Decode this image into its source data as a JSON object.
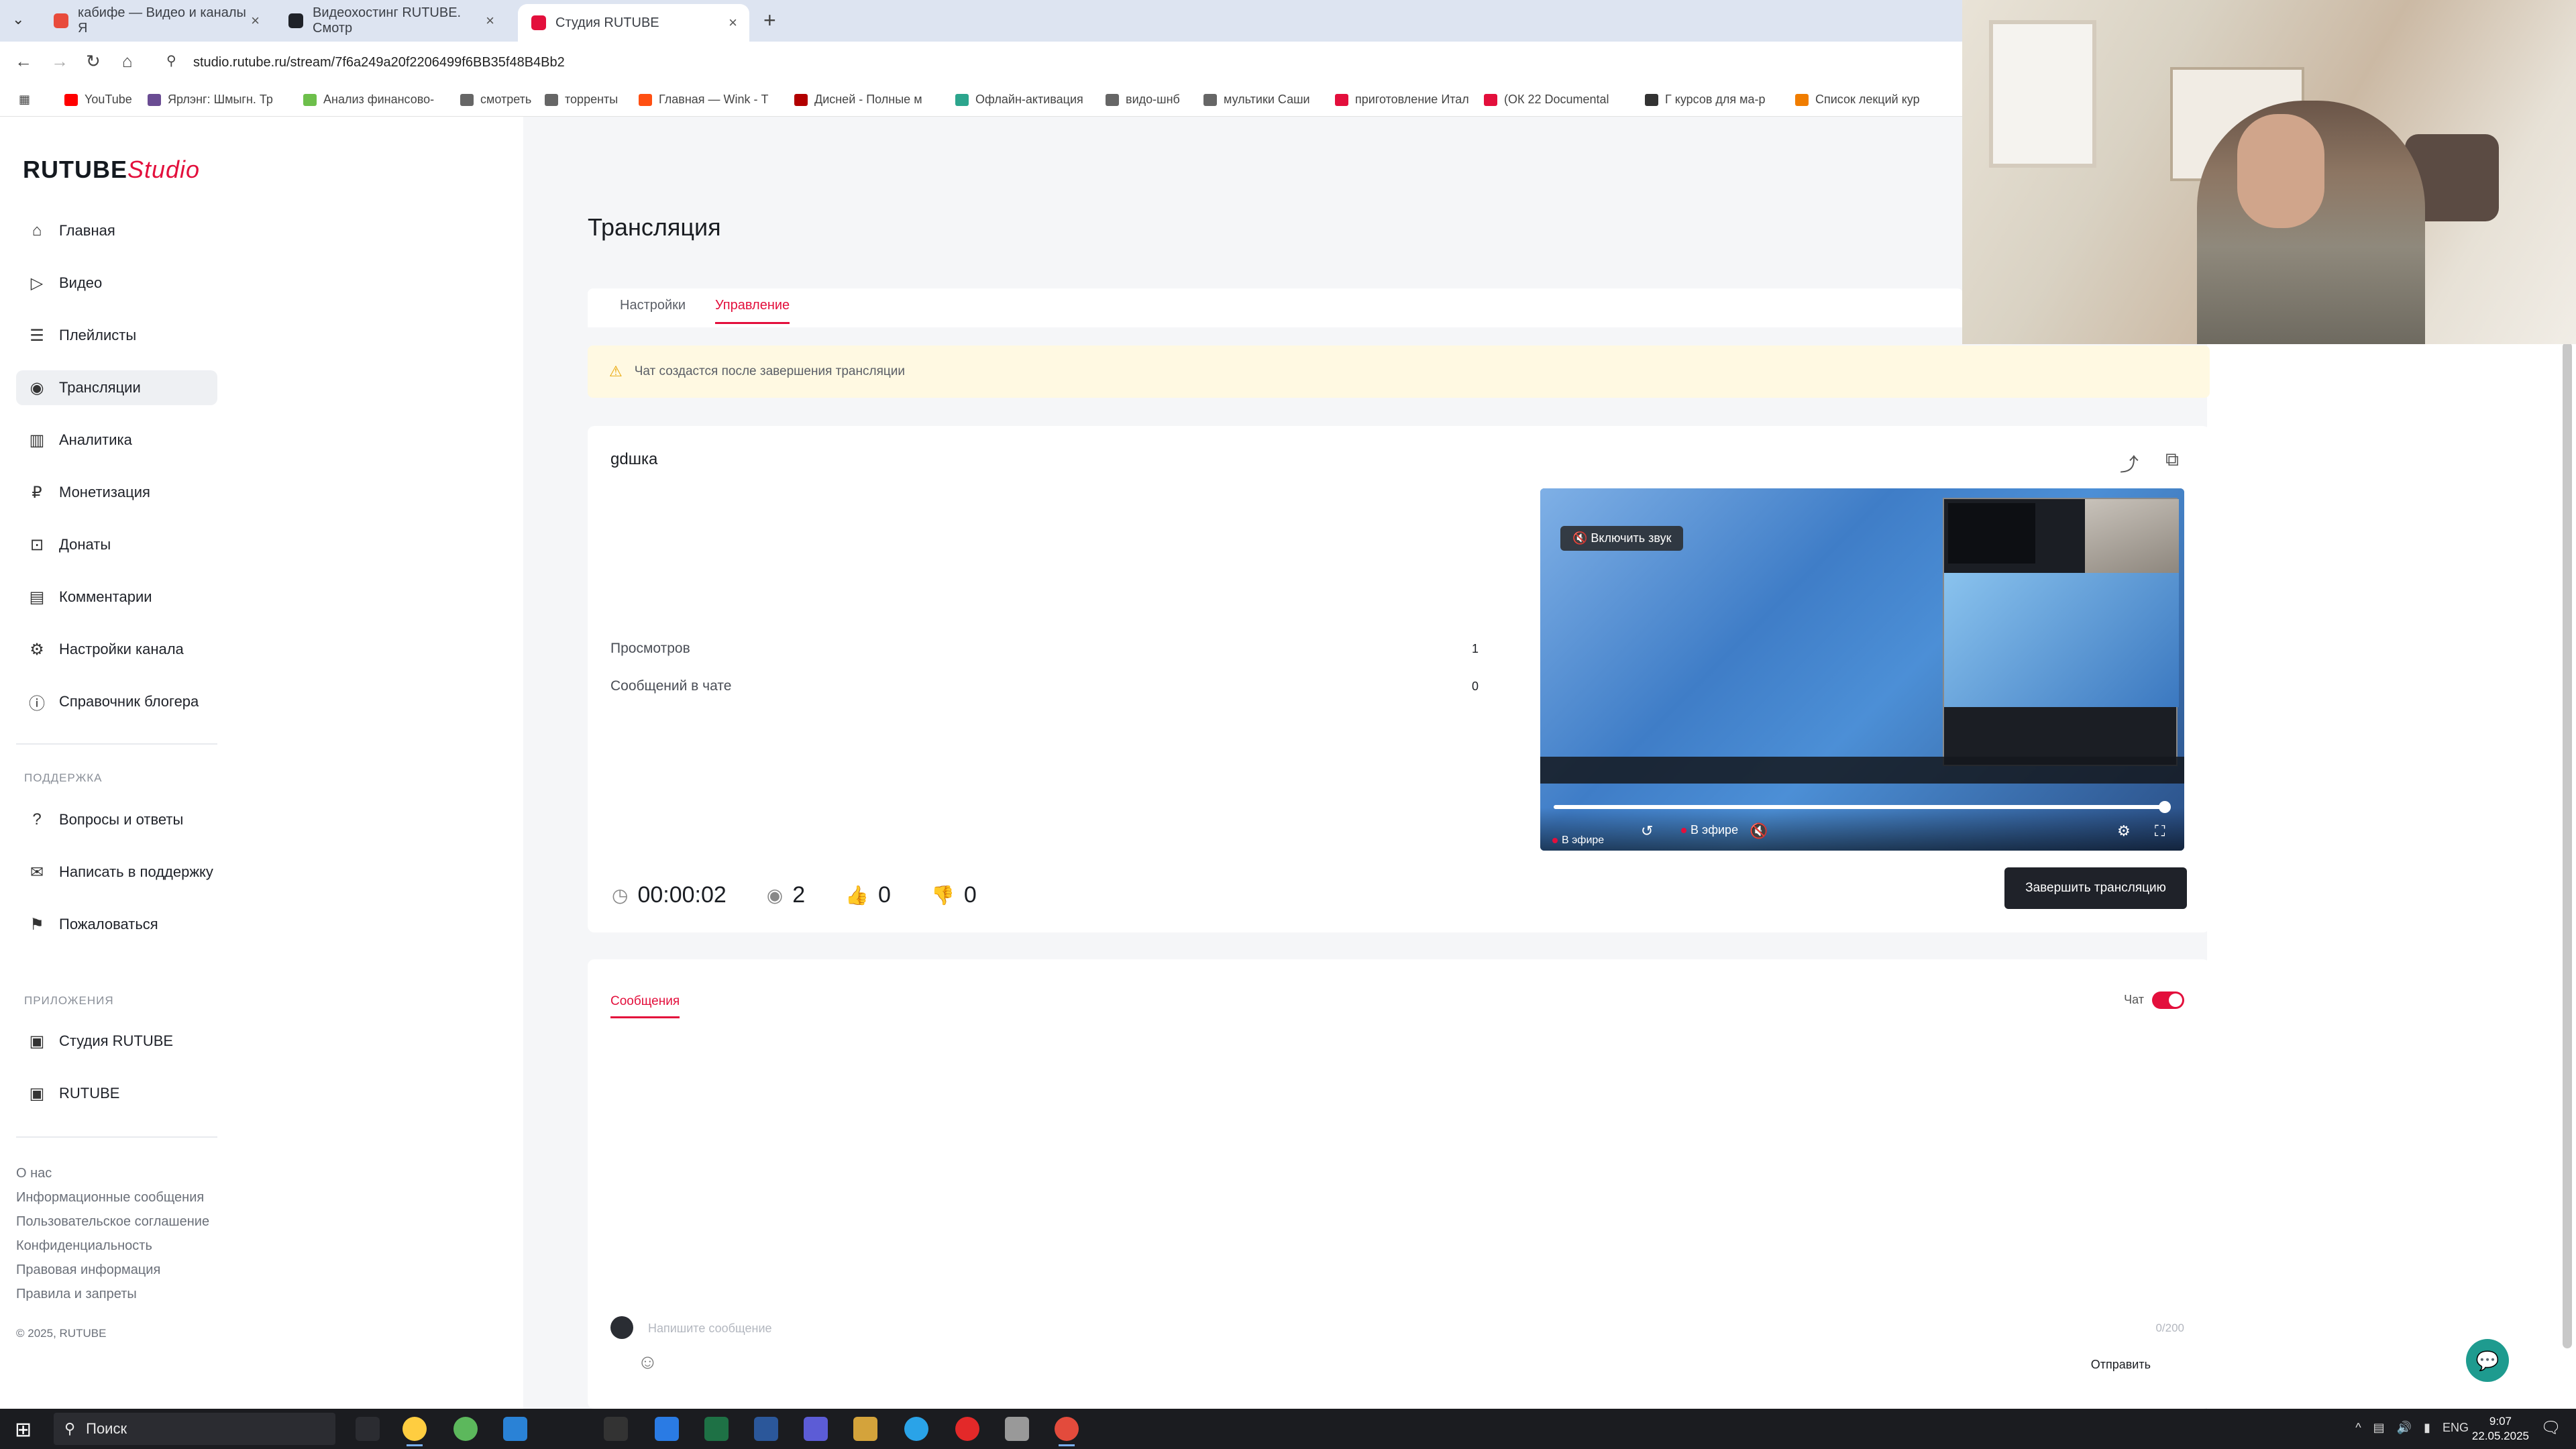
{
  "browser": {
    "tabs": [
      {
        "label": "кабифе — Видео и каналы Я",
        "favicon_color": "#e84b3c"
      },
      {
        "label": "Видеохостинг RUTUBE. Смотр",
        "favicon_color": "#1f2229"
      },
      {
        "label": "Студия RUTUBE",
        "favicon_color": "#e30f3c"
      }
    ],
    "url": "studio.rutube.ru/stream/7f6a249a20f2206499f6BB35f48B4Bb2",
    "bookmarks": [
      {
        "label": "YouTube",
        "color": "#ff0000"
      },
      {
        "label": "Ярлэнг: Шмыгн. Тр",
        "color": "#6a4c93"
      },
      {
        "label": "Анализ финансово-",
        "color": "#6dbf4b"
      },
      {
        "label": "смотреть",
        "color": "#666"
      },
      {
        "label": "торренты",
        "color": "#666"
      },
      {
        "label": "Главная — Wink - Т",
        "color": "#ff4f12"
      },
      {
        "label": "Дисней - Полные м",
        "color": "#b20000"
      },
      {
        "label": "Офлайн-активация",
        "color": "#2ca58d"
      },
      {
        "label": "видо-шнб",
        "color": "#666"
      },
      {
        "label": "мультики Саши",
        "color": "#666"
      },
      {
        "label": "приготовление Итал",
        "color": "#e30f3c"
      },
      {
        "label": "(ОК 22 Documental",
        "color": "#e30f3c"
      },
      {
        "label": "Г курсов для ма-р",
        "color": "#333"
      },
      {
        "label": "Список лекций кур",
        "color": "#f07d00"
      }
    ]
  },
  "logo": {
    "brand": "RUTUBE",
    "product": "Studio"
  },
  "sidebar": {
    "items": [
      {
        "label": "Главная",
        "icon": "home-icon",
        "glyph": "⌂"
      },
      {
        "label": "Видео",
        "icon": "video-icon",
        "glyph": "▷"
      },
      {
        "label": "Плейлисты",
        "icon": "playlist-icon",
        "glyph": "☰"
      },
      {
        "label": "Трансляции",
        "icon": "broadcast-icon",
        "glyph": "◉"
      },
      {
        "label": "Аналитика",
        "icon": "analytics-icon",
        "glyph": "▥"
      },
      {
        "label": "Монетизация",
        "icon": "monetization-icon",
        "glyph": "₽"
      },
      {
        "label": "Донаты",
        "icon": "donate-icon",
        "glyph": "⊡"
      },
      {
        "label": "Комментарии",
        "icon": "comments-icon",
        "glyph": "▤"
      },
      {
        "label": "Настройки канала",
        "icon": "settings-icon",
        "glyph": "⚙"
      },
      {
        "label": "Справочник блогера",
        "icon": "info-icon",
        "glyph": "ⓘ"
      }
    ],
    "support_heading": "ПОДДЕРЖКА",
    "support_items": [
      {
        "label": "Вопросы и ответы",
        "icon": "help-icon",
        "glyph": "?"
      },
      {
        "label": "Написать в поддержку",
        "icon": "mail-icon",
        "glyph": "✉"
      },
      {
        "label": "Пожаловаться",
        "icon": "flag-icon",
        "glyph": "⚑"
      }
    ],
    "apps_heading": "ПРИЛОЖЕНИЯ",
    "app_items": [
      {
        "label": "Студия RUTUBE",
        "icon": "studio-app-icon",
        "glyph": "▣"
      },
      {
        "label": "RUTUBE",
        "icon": "rutube-app-icon",
        "glyph": "▣"
      }
    ],
    "footer_links": [
      "О нас",
      "Информационные сообщения",
      "Пользовательское соглашение",
      "Конфиденциальность",
      "Правовая информация",
      "Правила и запреты"
    ],
    "copyright": "© 2025, RUTUBE"
  },
  "page": {
    "title": "Трансляция",
    "tabs": [
      "Настройки",
      "Управление"
    ],
    "notice": "Чат создастся после завершения трансляции",
    "stream_name": "gdшка",
    "stats": [
      {
        "label": "Просмотров",
        "value": "1"
      },
      {
        "label": "Сообщений в чате",
        "value": "0"
      }
    ],
    "counters": {
      "time": "00:00:02",
      "viewers": "2",
      "likes": "0",
      "dislikes": "0"
    },
    "end_button": "Завершить трансляцию"
  },
  "player": {
    "unmute_label": "Включить звук",
    "live_label": "В эфире",
    "live_label_2": "В эфире",
    "progress": 0.99
  },
  "chat": {
    "tab_label": "Сообщения",
    "toggle_label": "Чат",
    "input_placeholder": "Напишите сообщение",
    "char_count": "0/200",
    "send_label": "Отправить"
  },
  "taskbar": {
    "search_placeholder": "Поиск",
    "lang": "ENG",
    "time": "9:07",
    "date": "22.05.2025"
  }
}
